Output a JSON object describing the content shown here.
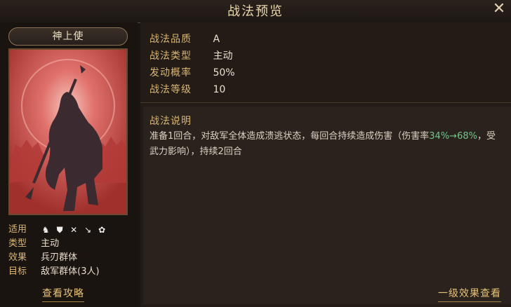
{
  "window": {
    "title": "战法预览",
    "close_glyph": "✕"
  },
  "tactic": {
    "name": "神上使"
  },
  "left_info": {
    "usage_label": "适用",
    "usage_icons": [
      "cavalry-icon",
      "shield-icon",
      "bow-icon",
      "spear-icon",
      "wheel-icon"
    ],
    "type_label": "类型",
    "type_value": "主动",
    "effect_label": "效果",
    "effect_value": "兵刃群体",
    "target_label": "目标",
    "target_value": "敌军群体(3人)",
    "strategy_link": "查看攻略"
  },
  "stats": {
    "quality_label": "战法品质",
    "quality_value": "A",
    "type_label": "战法类型",
    "type_value": "主动",
    "chance_label": "发动概率",
    "chance_value": "50%",
    "level_label": "战法等级",
    "level_value": "10"
  },
  "description": {
    "title": "战法说明",
    "text_part1": "准备1回合，对敌军全体造成溃逃状态，每回合持续造成伤害（伤害率",
    "highlight": "34%→68%",
    "text_part2": "，受武力影响），持续2回合"
  },
  "effect_link": "一级效果查看",
  "colors": {
    "accent_gold": "#d9b574",
    "highlight_green": "#6fc78a",
    "card_red": "#c44b44"
  }
}
